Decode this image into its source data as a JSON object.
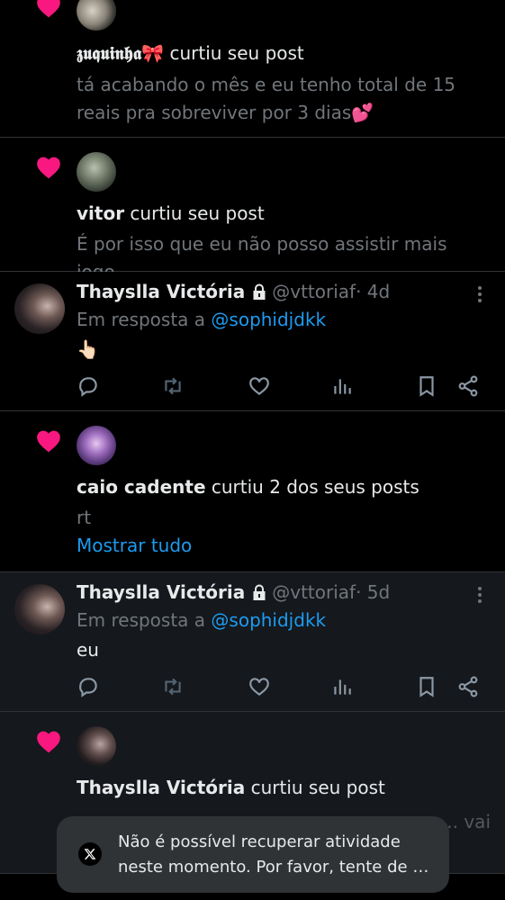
{
  "colors": {
    "heart": "#f91880",
    "link": "#1d9bf0",
    "muted": "#71767b"
  },
  "notifications": [
    {
      "user": "𝖟𝖚𝖖𝖚𝖎𝖓𝖍𝖆🎀",
      "action": " curtiu seu post",
      "excerpt": "tá acabando o mês e eu tenho total de 15 reais pra sobreviver por 3 dias💕"
    },
    {
      "user": "vitor",
      "action": " curtiu seu post",
      "excerpt": "É por isso que eu não posso assistir mais jogo"
    },
    {
      "user": "caio cadente",
      "action": " curtiu 2 dos seus posts",
      "excerpt": "rt",
      "show_all": "Mostrar tudo"
    },
    {
      "user": "Thayslla Victória",
      "action": " curtiu seu post",
      "excerpt": "s... vai"
    }
  ],
  "replies": [
    {
      "name": "Thayslla Victória",
      "handle": "@vttoriaf",
      "time": " · 4d",
      "reply_prefix": "Em resposta a ",
      "reply_to": "@sophidjdkk",
      "text": "👆🏻"
    },
    {
      "name": "Thayslla Victória",
      "handle": "@vttoriaf",
      "time": " · 5d",
      "reply_prefix": "Em resposta a ",
      "reply_to": "@sophidjdkk",
      "text": "eu"
    }
  ],
  "toast": {
    "line1": "Não é possível recuperar atividade",
    "line2": "neste momento. Por favor, tente de no…"
  },
  "icons": [
    "heart-icon",
    "lock-icon",
    "reply-icon",
    "retweet-icon",
    "like-icon",
    "views-icon",
    "bookmark-icon",
    "share-icon",
    "more-icon",
    "x-logo-icon"
  ]
}
